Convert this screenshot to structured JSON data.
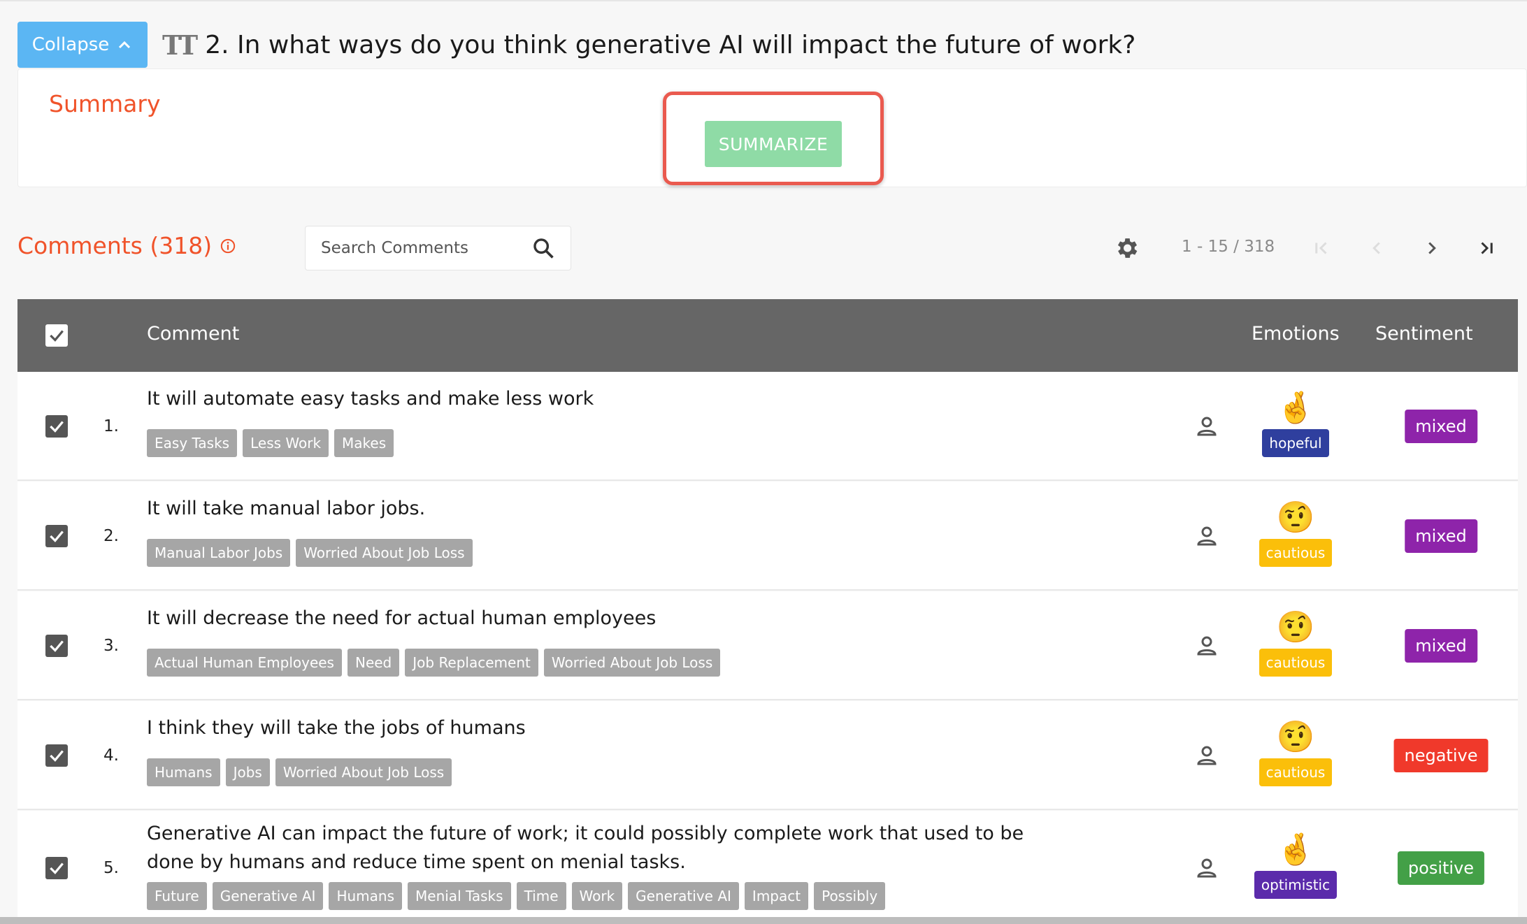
{
  "question": {
    "collapse_label": "Collapse",
    "title": "2. In what ways do you think generative AI will impact the future of work?"
  },
  "summary": {
    "title": "Summary",
    "summarize_label": "SUMMARIZE"
  },
  "comments": {
    "title": "Comments (318)",
    "search_placeholder": "Search Comments",
    "pagination": "1 - 15 / 318"
  },
  "table": {
    "headers": {
      "comment": "Comment",
      "emotions": "Emotions",
      "sentiment": "Sentiment"
    },
    "rows": [
      {
        "num": "1.",
        "text": "It will automate easy tasks and make less work",
        "tags": [
          "Easy Tasks",
          "Less Work",
          "Makes"
        ],
        "emotion": "hopeful",
        "emotion_icon": "crossed-fingers-icon",
        "emotion_color": "#2f3f9e",
        "sentiment": "mixed",
        "sentiment_color": "#8e24aa"
      },
      {
        "num": "2.",
        "text": "It will take manual labor jobs.",
        "tags": [
          "Manual Labor Jobs",
          "Worried About Job Loss"
        ],
        "emotion": "cautious",
        "emotion_icon": "raised-eyebrow-face-icon",
        "emotion_color": "#fbbf0a",
        "sentiment": "mixed",
        "sentiment_color": "#8e24aa"
      },
      {
        "num": "3.",
        "text": "It will decrease the need for actual human employees",
        "tags": [
          "Actual Human Employees",
          "Need",
          "Job Replacement",
          "Worried About Job Loss"
        ],
        "emotion": "cautious",
        "emotion_icon": "raised-eyebrow-face-icon",
        "emotion_color": "#fbbf0a",
        "sentiment": "mixed",
        "sentiment_color": "#8e24aa"
      },
      {
        "num": "4.",
        "text": "I think they will take the jobs of humans",
        "tags": [
          "Humans",
          "Jobs",
          "Worried About Job Loss"
        ],
        "emotion": "cautious",
        "emotion_icon": "raised-eyebrow-face-icon",
        "emotion_color": "#fbbf0a",
        "sentiment": "negative",
        "sentiment_color": "#f0392b"
      },
      {
        "num": "5.",
        "text": "Generative AI can impact the future of work; it could possibly complete work that used to be done by humans and reduce time spent on menial tasks.",
        "tags": [
          "Future",
          "Generative AI",
          "Humans",
          "Menial Tasks",
          "Time",
          "Work",
          "Generative AI",
          "Impact",
          "Possibly"
        ],
        "emotion": "optimistic",
        "emotion_icon": "crossed-fingers-icon",
        "emotion_color": "#5b2bab",
        "sentiment": "positive",
        "sentiment_color": "#43a047"
      }
    ]
  }
}
